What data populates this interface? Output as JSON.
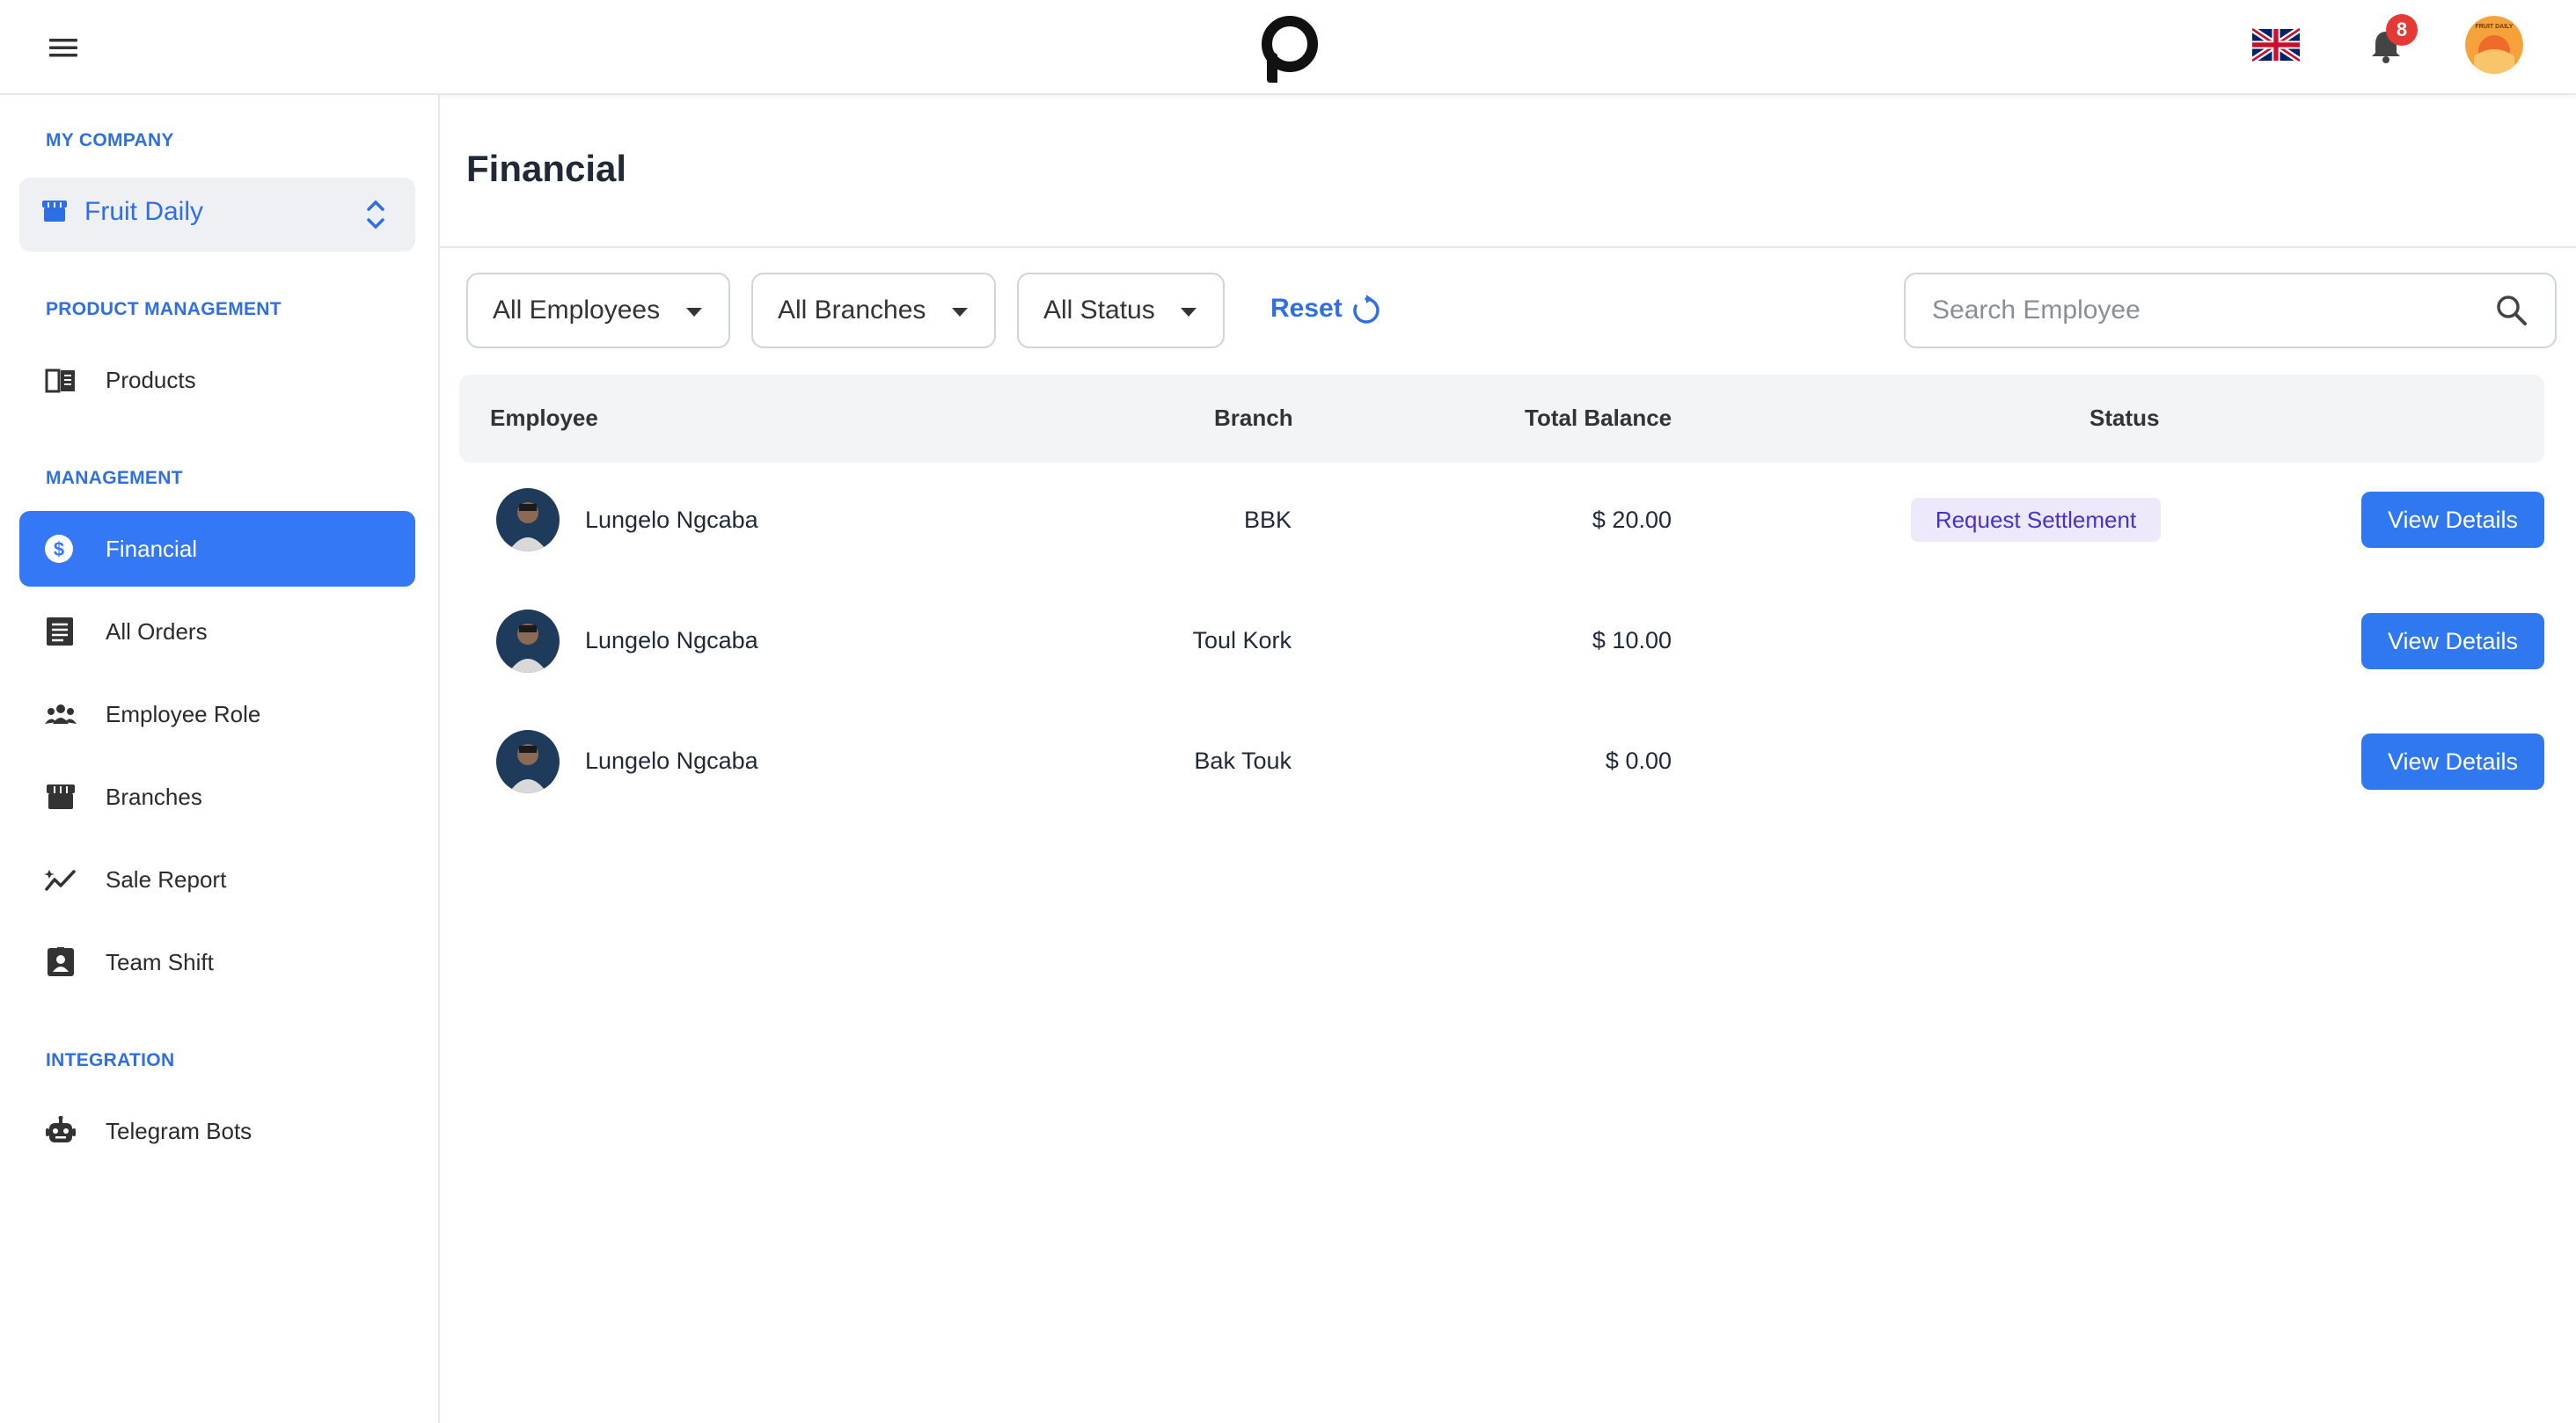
{
  "header": {
    "notification_count": "8",
    "brand_mark": "FRUIT DAILY"
  },
  "sidebar": {
    "my_company_title": "MY COMPANY",
    "company_name": "Fruit Daily",
    "product_management_title": "PRODUCT MANAGEMENT",
    "management_title": "MANAGEMENT",
    "integration_title": "INTEGRATION",
    "items": [
      {
        "label": "Products",
        "icon": "book-icon"
      },
      {
        "label": "Financial",
        "icon": "dollar-icon",
        "active": true
      },
      {
        "label": "All Orders",
        "icon": "list-icon"
      },
      {
        "label": "Employee Role",
        "icon": "people-icon"
      },
      {
        "label": "Branches",
        "icon": "store-icon"
      },
      {
        "label": "Sale Report",
        "icon": "trend-icon"
      },
      {
        "label": "Team Shift",
        "icon": "id-badge-icon"
      },
      {
        "label": "Telegram Bots",
        "icon": "robot-icon"
      }
    ]
  },
  "main": {
    "title": "Financial",
    "filters": {
      "employees": "All Employees",
      "branches": "All Branches",
      "status": "All Status",
      "reset": "Reset"
    },
    "search": {
      "placeholder": "Search Employee",
      "value": ""
    },
    "table": {
      "columns": [
        "Employee",
        "Branch",
        "Total Balance",
        "Status"
      ],
      "rows": [
        {
          "employee": "Lungelo Ngcaba",
          "branch": "BBK",
          "balance": "$ 20.00",
          "status": "Request Settlement",
          "action": "View Details"
        },
        {
          "employee": "Lungelo Ngcaba",
          "branch": "Toul Kork",
          "balance": "$ 10.00",
          "status": "",
          "action": "View Details"
        },
        {
          "employee": "Lungelo Ngcaba",
          "branch": "Bak Touk",
          "balance": "$ 0.00",
          "status": "",
          "action": "View Details"
        }
      ]
    }
  },
  "colors": {
    "accent": "#2f6fe4",
    "active_nav": "#3478f6",
    "button": "#2f78f0",
    "badge": "#e53935",
    "status_pill_bg": "#ede9fb",
    "status_pill_text": "#4b2fc9"
  }
}
